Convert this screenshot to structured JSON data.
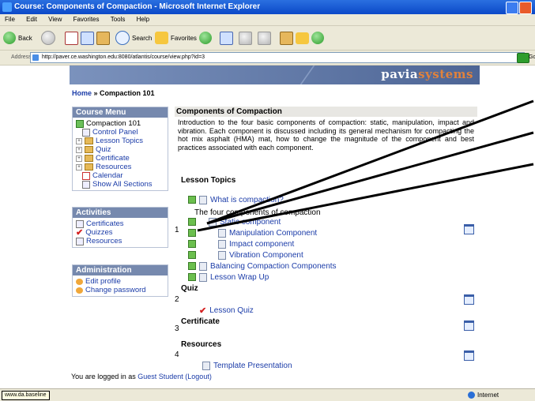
{
  "window": {
    "title": "Course: Components of Compaction - Microsoft Internet Explorer"
  },
  "menu": [
    "File",
    "Edit",
    "View",
    "Favorites",
    "Tools",
    "Help"
  ],
  "toolbar": {
    "back": "Back",
    "search": "Search",
    "favorites": "Favorites"
  },
  "address": {
    "label": "Address",
    "url": "http://paver.ce.washington.edu:8080/atlantis/course/view.php?id=3",
    "go": "Go"
  },
  "banner": {
    "logo_main": "pavia",
    "logo_accent": "systems"
  },
  "breadcrumb": {
    "home": "Home",
    "sep": " » ",
    "current": "Compaction 101"
  },
  "course_menu": {
    "title": "Course Menu",
    "items": [
      {
        "label": "Compaction 101"
      },
      {
        "label": "Control Panel"
      },
      {
        "label": "Lesson Topics"
      },
      {
        "label": "Quiz"
      },
      {
        "label": "Certificate"
      },
      {
        "label": "Resources"
      },
      {
        "label": "Calendar"
      },
      {
        "label": "Show All Sections"
      }
    ]
  },
  "activities": {
    "title": "Activities",
    "items": [
      {
        "label": "Certificates"
      },
      {
        "label": "Quizzes"
      },
      {
        "label": "Resources"
      }
    ]
  },
  "administration": {
    "title": "Administration",
    "items": [
      {
        "label": "Edit profile"
      },
      {
        "label": "Change password"
      }
    ]
  },
  "main": {
    "heading": "Components of Compaction",
    "intro": "Introduction to the four basic components of compaction: static, manipulation, impact and vibration. Each component is discussed including its general mechanism for compacting the hot mix asphalt (HMA) mat, how to change the magnitude of the component and best practices associated with each component.",
    "lesson_topics": {
      "title": "Lesson Topics",
      "first": "What is compaction?",
      "caption": "The four components of compaction",
      "num": "1",
      "items": [
        "Static component",
        "Manipulation Component",
        "Impact component",
        "Vibration Component",
        "Balancing Compaction Components",
        "Lesson Wrap Up"
      ]
    },
    "quiz": {
      "title": "Quiz",
      "num": "2",
      "item": "Lesson Quiz"
    },
    "certificate": {
      "title": "Certificate",
      "num": "3"
    },
    "resources": {
      "title": "Resources",
      "num": "4",
      "item": "Template Presentation"
    },
    "footer": {
      "prefix": "You are logged in as ",
      "user": "Guest Student",
      "logout": "(Logout)"
    }
  },
  "status": {
    "tooltip": "www.da.baseline",
    "zone": "Internet"
  }
}
